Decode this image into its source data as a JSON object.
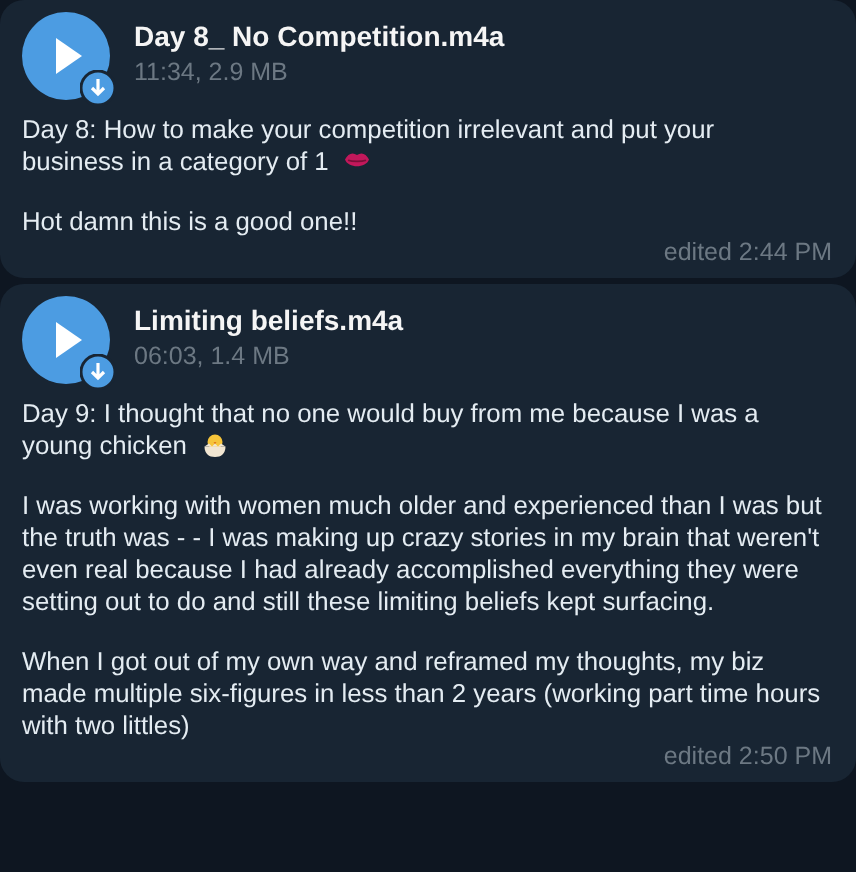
{
  "messages": [
    {
      "title": "Day 8_ No Competition.m4a",
      "meta": "11:34, 2.9 MB",
      "paragraphs": [
        {
          "text": "Day 8: How to make your competition irrelevant and put your business in a category of 1"
        },
        {
          "text": "Hot damn this is a good one!!"
        }
      ],
      "edited": "edited 2:44 PM"
    },
    {
      "title": "Limiting beliefs.m4a",
      "meta": "06:03, 1.4 MB",
      "paragraphs": [
        {
          "text": "Day 9: I thought that no one would buy from me because I was a young chicken"
        },
        {
          "text": "I was working with women much older and experienced than I was but the truth was - - I was making up crazy stories in my brain that weren't even real because I had already accomplished everything they were setting out to do and still these limiting beliefs kept surfacing."
        },
        {
          "text": "When I got out of my own way and reframed my thoughts, my biz made multiple six-figures in less than 2 years (working part time hours with two littles)"
        }
      ],
      "edited": "edited 2:50 PM"
    }
  ]
}
